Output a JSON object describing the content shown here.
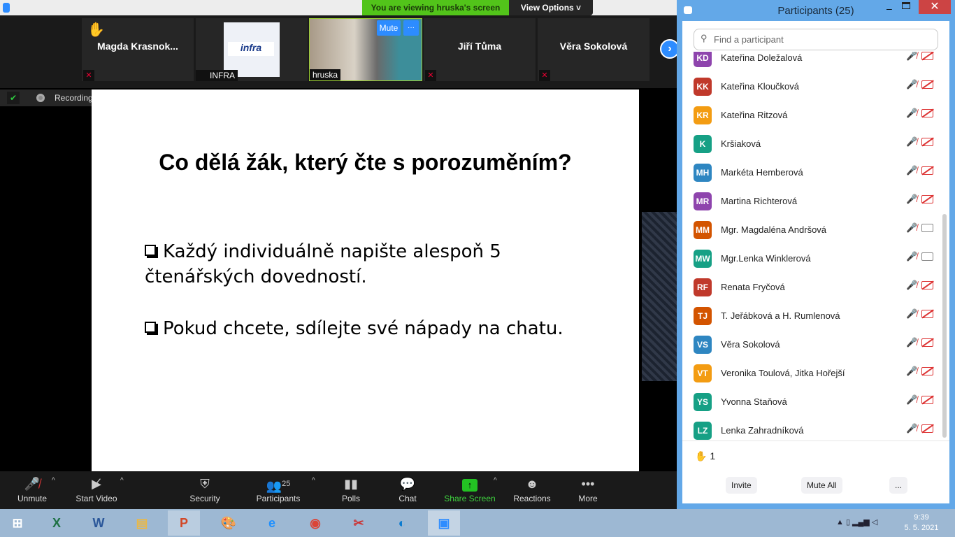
{
  "banner": {
    "viewing": "You are viewing hruska's screen",
    "view_options": "View Options ˅"
  },
  "tiles": [
    {
      "name": "Magda  Krasnok...",
      "hand": "✋"
    },
    {
      "label": "INFRA",
      "logo": "infra"
    },
    {
      "label": "hruska",
      "mute": "Mute",
      "more": "···"
    },
    {
      "name": "Jiří Tůma"
    },
    {
      "name": "Věra Sokolová"
    }
  ],
  "recording": {
    "label": "Recording...",
    "pause": "❚❚",
    "stop": "■"
  },
  "slide": {
    "title": "Co dělá žák, který čte s porozuměním?",
    "bullets": [
      "Každý individuálně napište alespoň 5 čtenářských dovedností.",
      "Pokud chcete, sdílejte své nápady na chatu."
    ]
  },
  "toolbar": {
    "unmute": "Unmute",
    "start_video": "Start Video",
    "security": "Security",
    "participants": "Participants",
    "participants_count": "25",
    "polls": "Polls",
    "chat": "Chat",
    "share_screen": "Share Screen",
    "reactions": "Reactions",
    "more": "More"
  },
  "panel": {
    "title": "Participants (25)",
    "search_placeholder": "Find a participant",
    "raised_hands": "1",
    "invite": "Invite",
    "mute_all": "Mute All",
    "more": "...",
    "participants": [
      {
        "initials": "KD",
        "name": "Kateřina Doležalová",
        "color": "#8e44ad",
        "video": false
      },
      {
        "initials": "KK",
        "name": "Kateřina Kloučková",
        "color": "#c0392b",
        "video": false
      },
      {
        "initials": "KR",
        "name": "Kateřina Ritzová",
        "color": "#f39c12",
        "video": false
      },
      {
        "initials": "K",
        "name": "Kršiaková",
        "color": "#16a085",
        "video": false
      },
      {
        "initials": "MH",
        "name": "Markéta Hemberová",
        "color": "#2e86c1",
        "video": false
      },
      {
        "initials": "MR",
        "name": "Martina Richterová",
        "color": "#8e44ad",
        "video": false
      },
      {
        "initials": "MM",
        "name": "Mgr. Magdaléna Andršová",
        "color": "#d35400",
        "video": true
      },
      {
        "initials": "MW",
        "name": "Mgr.Lenka Winklerová",
        "color": "#16a085",
        "video": true
      },
      {
        "initials": "RF",
        "name": "Renata Fryčová",
        "color": "#c0392b",
        "video": false
      },
      {
        "initials": "TJ",
        "name": "T. Jeřábková a H. Rumlenová",
        "color": "#d35400",
        "video": false
      },
      {
        "initials": "VS",
        "name": "Věra Sokolová",
        "color": "#2e86c1",
        "video": false
      },
      {
        "initials": "VT",
        "name": "Veronika Toulová, Jitka Hořejší",
        "color": "#f39c12",
        "video": false
      },
      {
        "initials": "YS",
        "name": "Yvonna Staňová",
        "color": "#16a085",
        "video": false
      },
      {
        "initials": "LZ",
        "name": "Lenka Zahradníková",
        "color": "#16a085",
        "video": false
      }
    ]
  },
  "taskbar": {
    "time": "9:39",
    "date": "5. 5. 2021"
  }
}
